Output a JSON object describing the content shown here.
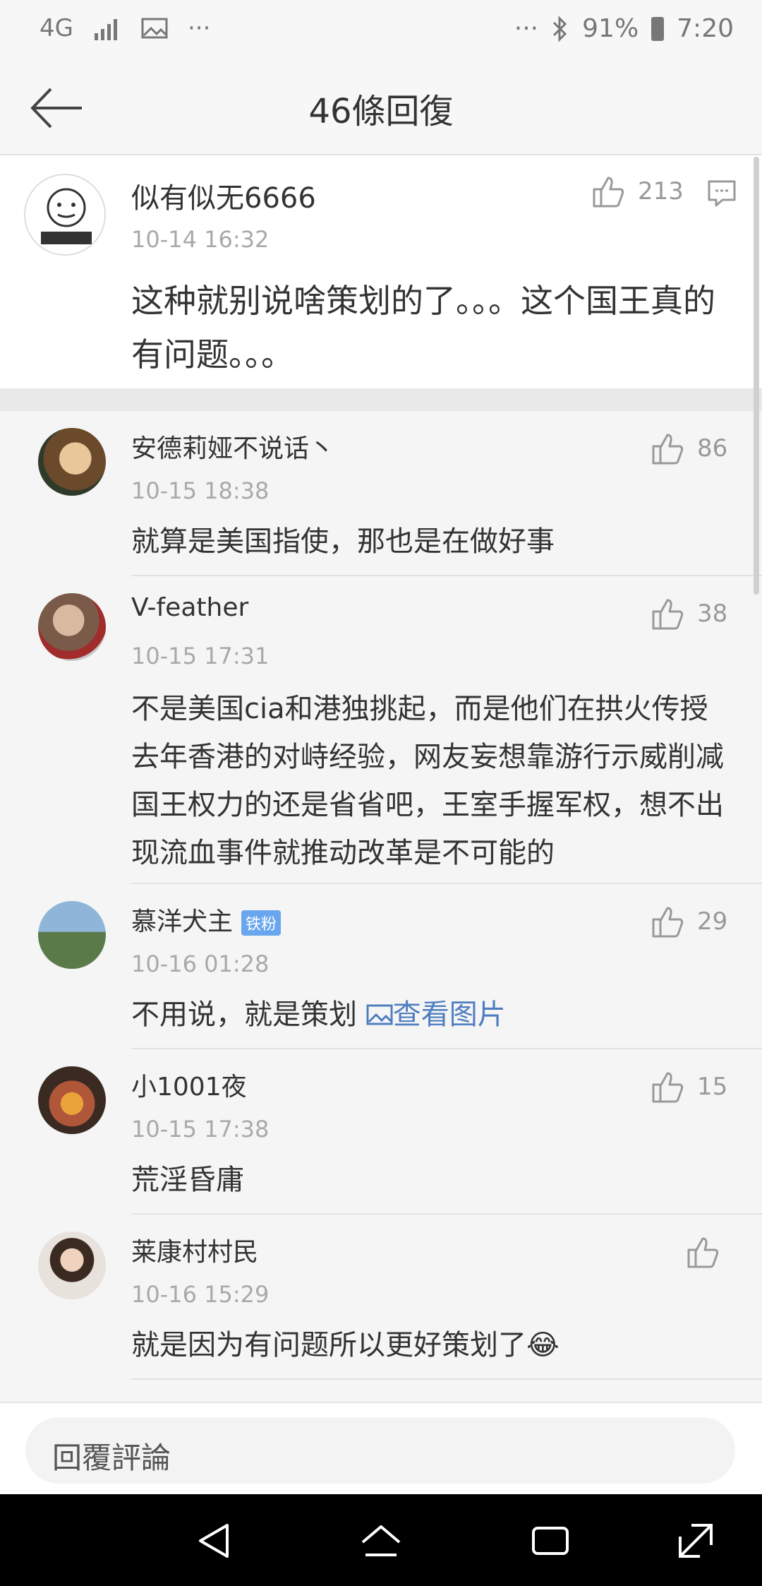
{
  "status_bar": {
    "network": "4G",
    "more_left": "···",
    "more_right": "···",
    "battery": "91%",
    "time": "7:20"
  },
  "header": {
    "title": "46條回復"
  },
  "top_comment": {
    "user": "似有似无6666",
    "time": "10-14 16:32",
    "text": "这种就别说啥策划的了。。。这个国王真的有问题。。。",
    "likes": "213"
  },
  "replies": [
    {
      "user": "安德莉娅不说话丶",
      "time": "10-15 18:38",
      "text": "就算是美国指使，那也是在做好事",
      "likes": "86"
    },
    {
      "user": "V-feather",
      "time": "10-15 17:31",
      "text": "不是美国cia和港独挑起，而是他们在拱火传授去年香港的对峙经验，网友妄想靠游行示威削减国王权力的还是省省吧，王室手握军权，想不出现流血事件就推动改革是不可能的",
      "likes": "38"
    },
    {
      "user": "慕洋犬主",
      "badge": "铁粉",
      "time": "10-16 01:28",
      "text": "不用说，就是策划",
      "link": "查看图片",
      "likes": "29"
    },
    {
      "user": "小1001夜",
      "time": "10-15 17:38",
      "text": "荒淫昏庸",
      "likes": "15"
    },
    {
      "user": "莱康村村民",
      "time": "10-16 15:29",
      "text": "就是因为有问题所以更好策划了",
      "emoji": "😂",
      "likes": ""
    }
  ],
  "reply_bar": {
    "placeholder": "回覆評論"
  },
  "colors": {
    "link": "#4f7ec0",
    "badge": "#6aa6ee",
    "muted": "#a9a9a9"
  }
}
